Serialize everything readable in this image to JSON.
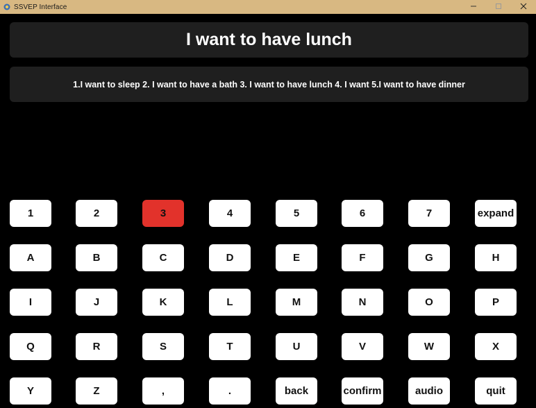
{
  "window": {
    "title": "SSVEP Interface",
    "controls": {
      "minimize": "—",
      "maximize": "☐",
      "close": "✕"
    }
  },
  "display": {
    "output_text": "I want to have lunch",
    "options_text": "1.I want to sleep 2. I want to have a bath 3. I want to have lunch 4. I want 5.I want to have dinner"
  },
  "colors": {
    "titlebar": "#d8b882",
    "background": "#000000",
    "panel": "#1f1f1f",
    "key": "#ffffff",
    "key_active": "#e2322b"
  },
  "keyboard": {
    "active_key": "3",
    "rows": [
      [
        "1",
        "2",
        "3",
        "4",
        "5",
        "6",
        "7",
        "expand"
      ],
      [
        "A",
        "B",
        "C",
        "D",
        "E",
        "F",
        "G",
        "H"
      ],
      [
        "I",
        "J",
        "K",
        "L",
        "M",
        "N",
        "O",
        "P"
      ],
      [
        "Q",
        "R",
        "S",
        "T",
        "U",
        "V",
        "W",
        "X"
      ],
      [
        "Y",
        "Z",
        ",",
        ".",
        "back",
        "confirm",
        "audio",
        "quit"
      ]
    ]
  }
}
